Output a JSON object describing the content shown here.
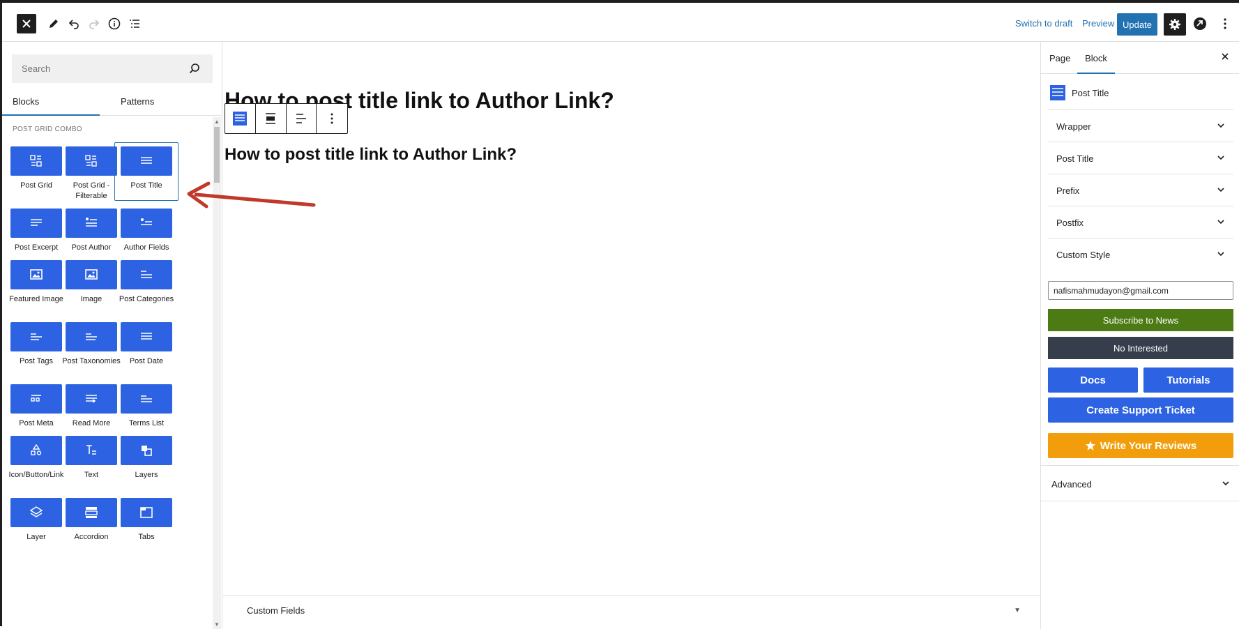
{
  "topbar": {
    "close_icon": "close-icon",
    "tools": [
      "edit-icon",
      "undo-icon",
      "redo-icon",
      "info-icon",
      "list-view-icon"
    ],
    "switch_to_draft": "Switch to draft",
    "preview": "Preview",
    "update": "Update"
  },
  "inserter": {
    "search_placeholder": "Search",
    "tabs": [
      "Blocks",
      "Patterns"
    ],
    "active_tab": "Blocks",
    "category": "POST GRID COMBO",
    "blocks": [
      {
        "label": "Post Grid",
        "icon": "grid-icon"
      },
      {
        "label": "Post Grid - Filterable",
        "icon": "grid-icon"
      },
      {
        "label": "Post Title",
        "icon": "title-icon",
        "selected": true
      },
      {
        "label": "Post Excerpt",
        "icon": "excerpt-icon"
      },
      {
        "label": "Post Author",
        "icon": "author-icon"
      },
      {
        "label": "Author Fields",
        "icon": "author-fields-icon"
      },
      {
        "label": "Featured Image",
        "icon": "image-icon"
      },
      {
        "label": "Image",
        "icon": "image-icon"
      },
      {
        "label": "Post Categories",
        "icon": "categories-icon"
      },
      {
        "label": "Post Tags",
        "icon": "tags-icon"
      },
      {
        "label": "Post Taxonomies",
        "icon": "taxonomies-icon"
      },
      {
        "label": "Post Date",
        "icon": "date-icon"
      },
      {
        "label": "Post Meta",
        "icon": "meta-icon"
      },
      {
        "label": "Read More",
        "icon": "read-more-icon"
      },
      {
        "label": "Terms List",
        "icon": "terms-icon"
      },
      {
        "label": "Icon/Button/Link",
        "icon": "shapes-icon"
      },
      {
        "label": "Text",
        "icon": "text-icon"
      },
      {
        "label": "Layers",
        "icon": "layers-icon"
      },
      {
        "label": "Layer",
        "icon": "layer-icon"
      },
      {
        "label": "Accordion",
        "icon": "accordion-icon"
      },
      {
        "label": "Tabs",
        "icon": "tabs-icon"
      }
    ]
  },
  "canvas": {
    "title_top": "How to post title link to Author Link?",
    "title_bottom": "How to post title link to Author Link?",
    "block_toolbar": [
      "block-type-icon",
      "align-icon",
      "text-align-icon",
      "more-options-icon"
    ],
    "custom_fields": "Custom Fields"
  },
  "sidebar": {
    "tabs": [
      "Page",
      "Block"
    ],
    "active_tab": "Block",
    "block_name": "Post Title",
    "panels": [
      "Wrapper",
      "Post Title",
      "Prefix",
      "Postfix",
      "Custom Style"
    ],
    "email": "nafismahmudayon@gmail.com",
    "subscribe": "Subscribe to News",
    "not_interested": "No Interested",
    "docs": "Docs",
    "tutorials": "Tutorials",
    "support": "Create Support Ticket",
    "reviews": "Write Your Reviews",
    "advanced": "Advanced"
  },
  "colors": {
    "accent": "#2271b1",
    "block_tile": "#2d63e2",
    "subscribe": "#4c7a14",
    "not_interested": "#363e4c",
    "reviews": "#f29e0c",
    "annotation_arrow": "#c0392b"
  }
}
